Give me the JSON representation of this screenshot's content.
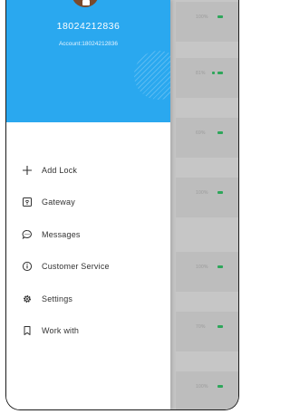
{
  "profile": {
    "phone": "18024212836",
    "account": "Account:18024212836"
  },
  "menu": [
    {
      "label": "Add Lock",
      "icon": "plus-icon"
    },
    {
      "label": "Gateway",
      "icon": "gateway-icon"
    },
    {
      "label": "Messages",
      "icon": "message-icon"
    },
    {
      "label": "Customer Service",
      "icon": "info-icon"
    },
    {
      "label": "Settings",
      "icon": "gear-icon"
    },
    {
      "label": "Work with",
      "icon": "bookmark-icon"
    }
  ],
  "background_list": [
    {
      "battery": "100%"
    },
    {
      "battery": "81%"
    },
    {
      "battery": "69%"
    },
    {
      "battery": "100%"
    },
    {
      "battery": "100%"
    },
    {
      "battery": "70%"
    },
    {
      "battery": "100%"
    }
  ],
  "colors": {
    "header": "#2aa8ef",
    "battery": "#2ea65a"
  }
}
